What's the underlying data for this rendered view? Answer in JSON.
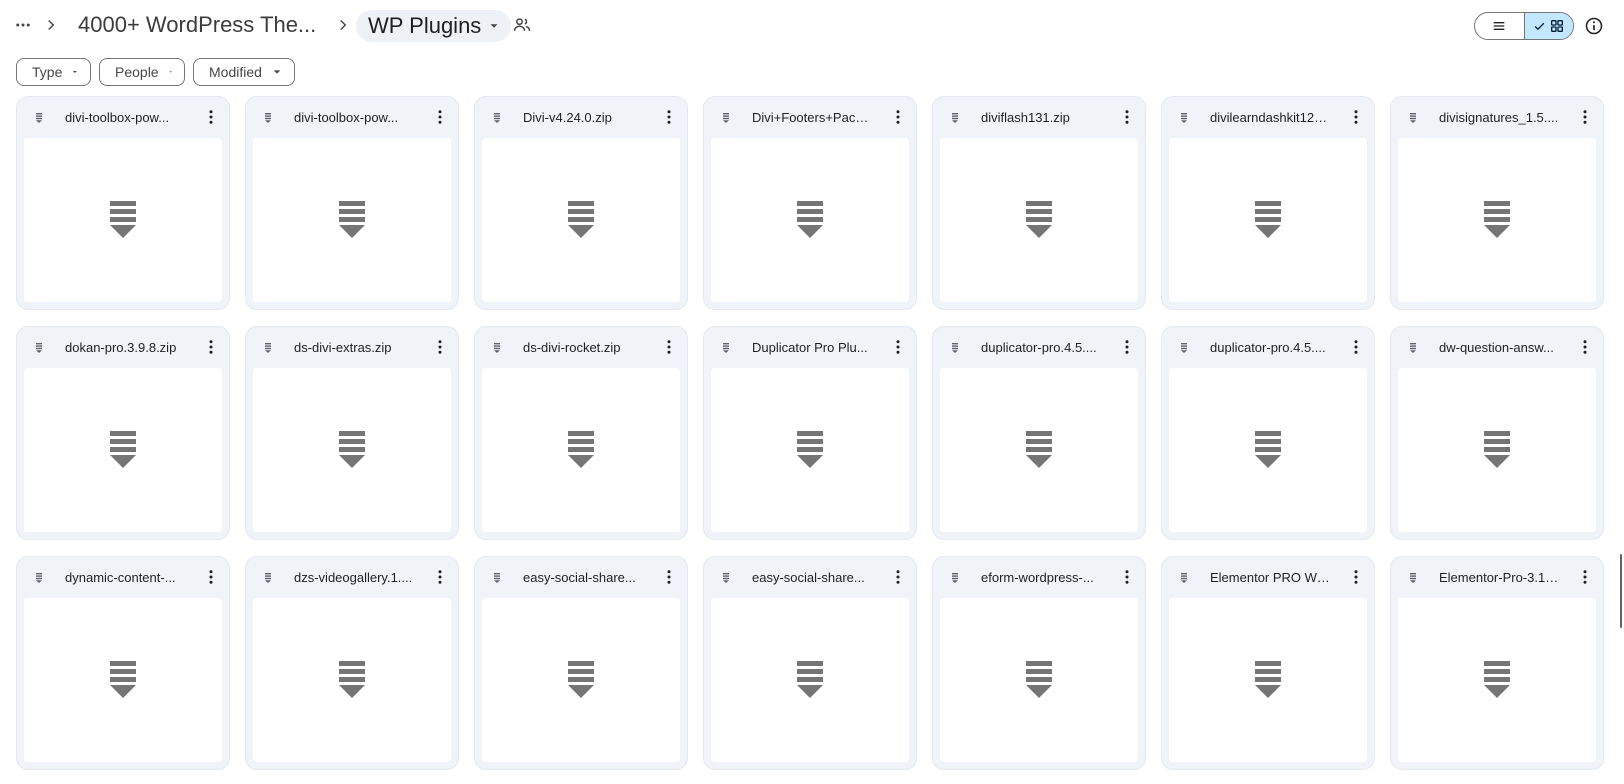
{
  "header": {
    "breadcrumb_parent": "4000+ WordPress The...",
    "current_folder": "WP Plugins"
  },
  "filters": [
    {
      "label": "Type"
    },
    {
      "label": "People"
    },
    {
      "label": "Modified"
    }
  ],
  "files": [
    {
      "name": "divi-toolbox-pow..."
    },
    {
      "name": "divi-toolbox-pow..."
    },
    {
      "name": "Divi-v4.24.0.zip"
    },
    {
      "name": "Divi+Footers+Pack..."
    },
    {
      "name": "diviflash131.zip"
    },
    {
      "name": "divilearndashkit121..."
    },
    {
      "name": "divisignatures_1.5...."
    },
    {
      "name": "dokan-pro.3.9.8.zip"
    },
    {
      "name": "ds-divi-extras.zip"
    },
    {
      "name": "ds-divi-rocket.zip"
    },
    {
      "name": "Duplicator Pro Plu..."
    },
    {
      "name": "duplicator-pro.4.5...."
    },
    {
      "name": "duplicator-pro.4.5...."
    },
    {
      "name": "dw-question-answ..."
    },
    {
      "name": "dynamic-content-..."
    },
    {
      "name": "dzs-videogallery.1...."
    },
    {
      "name": "easy-social-share..."
    },
    {
      "name": "easy-social-share..."
    },
    {
      "name": "eform-wordpress-..."
    },
    {
      "name": "Elementor PRO Wo..."
    },
    {
      "name": "Elementor-Pro-3.1...."
    }
  ],
  "colors": {
    "card_bg": "#f0f4f9",
    "active_toggle": "#c2e7ff",
    "icon_gray": "#757575"
  },
  "icons": {
    "more": "more-horiz-icon",
    "chevron": "chevron-right-icon",
    "shared": "people-icon",
    "list": "list-view-icon",
    "grid": "grid-view-icon",
    "check": "check-icon",
    "info": "info-icon",
    "zip": "zip-file-icon",
    "kebab": "more-vert-icon"
  }
}
